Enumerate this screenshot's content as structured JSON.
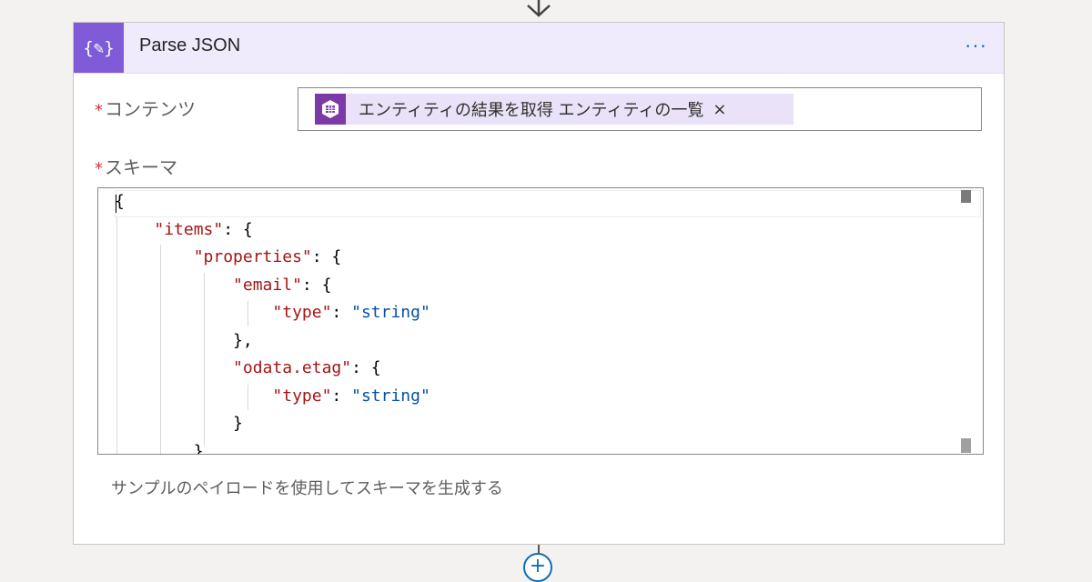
{
  "action": {
    "icon": "braces-pencil-icon",
    "icon_glyph": "{✎}",
    "title": "Parse JSON",
    "more_glyph": "···",
    "accent": "#7f5bd8"
  },
  "fields": {
    "required_mark": "*",
    "content_label": "コンテンツ",
    "schema_label": "スキーマ",
    "content_token": {
      "icon": "table-storage-icon",
      "label": "エンティティの結果を取得 エンティティの一覧",
      "close_glyph": "×",
      "color": "#7c3aa6"
    }
  },
  "schema_lines": [
    "{",
    "    \"items\": {",
    "        \"properties\": {",
    "            \"email\": {",
    "                \"type\": \"string\"",
    "            },",
    "            \"odata.etag\": {",
    "                \"type\": \"string\"",
    "            }",
    "        },"
  ],
  "sample_link": "サンプルのペイロードを使用してスキーマを生成する",
  "add_glyph": "+"
}
